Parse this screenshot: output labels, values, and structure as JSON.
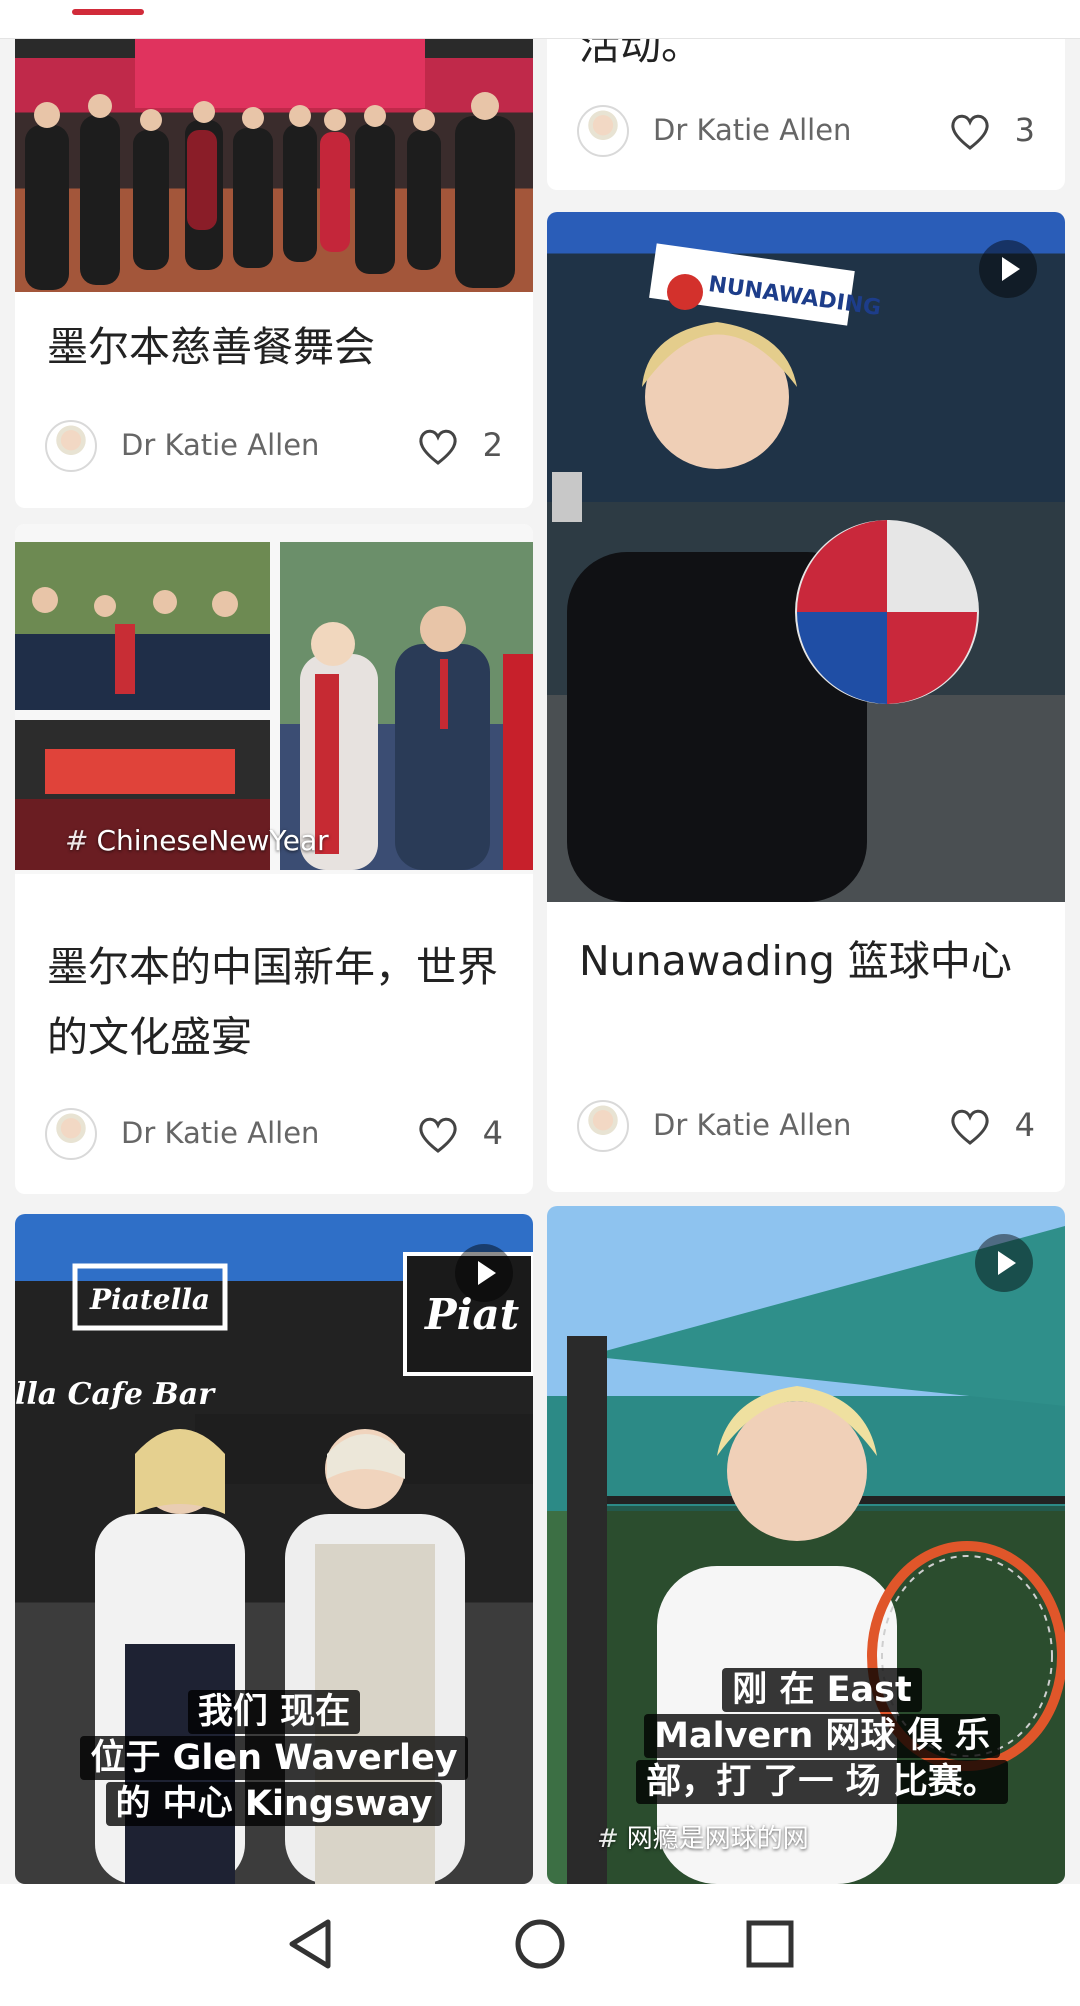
{
  "feed": {
    "left": [
      {
        "title": "墨尔本慈善餐舞会",
        "author": "Dr Katie Allen",
        "likes": "2"
      },
      {
        "tag": "ChineseNewYear",
        "title": "墨尔本的中国新年，世界的文化盛宴",
        "author": "Dr Katie Allen",
        "likes": "4"
      },
      {
        "subtitle": [
          "我们 现在",
          "位于 Glen Waverley",
          "的 中心 Kingsway"
        ]
      }
    ],
    "right": [
      {
        "title_partial": "活动。",
        "author": "Dr Katie Allen",
        "likes": "3"
      },
      {
        "title": "Nunawading 篮球中心",
        "author": "Dr Katie Allen",
        "likes": "4"
      },
      {
        "subtitle": [
          "刚 在 East",
          "Malvern 网球 俱 乐",
          "部，打 了一 场 比赛。"
        ],
        "tag": "网瘾是网球的网"
      }
    ]
  },
  "colors": {
    "accent": "#d12b3a",
    "background": "#f3f3f3"
  },
  "icons": [
    "heart-icon",
    "play-icon",
    "hashtag-icon",
    "back-icon",
    "home-icon",
    "recents-icon"
  ]
}
